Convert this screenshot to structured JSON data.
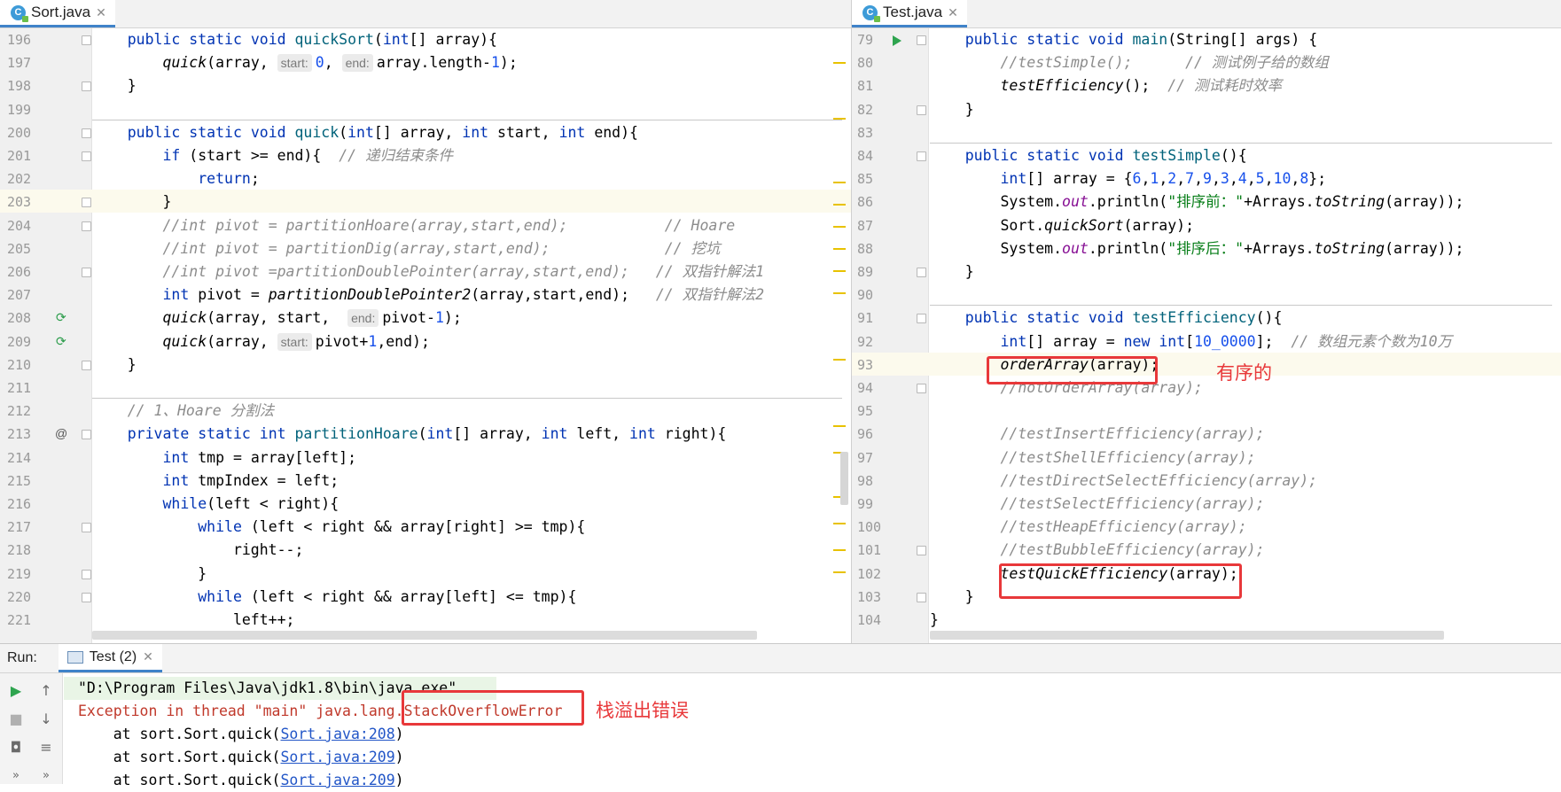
{
  "left_editor": {
    "tab_label": "Sort.java",
    "tab_icon": "java-class-icon",
    "lines": [
      {
        "n": "196",
        "segs": [
          [
            "",
            "    "
          ],
          [
            "kw",
            "public static void "
          ],
          [
            "m",
            "quickSort"
          ],
          [
            "",
            "("
          ],
          [
            "kw",
            "int"
          ],
          [
            "",
            "[] array){"
          ]
        ]
      },
      {
        "n": "197",
        "segs": [
          [
            "",
            "        "
          ],
          [
            "it",
            "quick"
          ],
          [
            "",
            "(array, "
          ],
          [
            "hint",
            "start:"
          ],
          [
            "n",
            "0"
          ],
          [
            "",
            ", "
          ],
          [
            "hint",
            "end:"
          ],
          [
            "",
            "array.length-"
          ],
          [
            "n",
            "1"
          ],
          [
            "",
            ");"
          ]
        ]
      },
      {
        "n": "198",
        "segs": [
          [
            "",
            "    }"
          ]
        ]
      },
      {
        "n": "199",
        "segs": []
      },
      {
        "n": "200",
        "segs": [
          [
            "",
            "    "
          ],
          [
            "kw",
            "public static void "
          ],
          [
            "m",
            "quick"
          ],
          [
            "",
            "("
          ],
          [
            "kw",
            "int"
          ],
          [
            "",
            "[] array, "
          ],
          [
            "kw",
            "int "
          ],
          [
            "",
            "start, "
          ],
          [
            "kw",
            "int "
          ],
          [
            "",
            "end){"
          ]
        ]
      },
      {
        "n": "201",
        "segs": [
          [
            "",
            "        "
          ],
          [
            "kw",
            "if "
          ],
          [
            "",
            "(start >= end){  "
          ],
          [
            "gr",
            "// 递归结束条件"
          ]
        ]
      },
      {
        "n": "202",
        "segs": [
          [
            "",
            "            "
          ],
          [
            "kw",
            "return"
          ],
          [
            "",
            ";"
          ]
        ]
      },
      {
        "n": "203",
        "segs": [
          [
            "",
            "        }"
          ]
        ]
      },
      {
        "n": "204",
        "segs": [
          [
            "",
            "        "
          ],
          [
            "gr",
            "//int pivot = partitionHoare(array,start,end);           // Hoare"
          ]
        ]
      },
      {
        "n": "205",
        "segs": [
          [
            "",
            "        "
          ],
          [
            "gr",
            "//int pivot = partitionDig(array,start,end);             // 挖坑"
          ]
        ]
      },
      {
        "n": "206",
        "segs": [
          [
            "",
            "        "
          ],
          [
            "gr",
            "//int pivot =partitionDoublePointer(array,start,end);   // 双指针解法1"
          ]
        ]
      },
      {
        "n": "207",
        "segs": [
          [
            "",
            "        "
          ],
          [
            "kw",
            "int "
          ],
          [
            "",
            "pivot = "
          ],
          [
            "it",
            "partitionDoublePointer2"
          ],
          [
            "",
            "(array,start,end);   "
          ],
          [
            "gr",
            "// 双指针解法2"
          ]
        ]
      },
      {
        "n": "208",
        "segs": [
          [
            "",
            "        "
          ],
          [
            "it",
            "quick"
          ],
          [
            "",
            "(array, start,  "
          ],
          [
            "hint",
            "end:"
          ],
          [
            "",
            "pivot-"
          ],
          [
            "n",
            "1"
          ],
          [
            "",
            ");"
          ]
        ]
      },
      {
        "n": "209",
        "segs": [
          [
            "",
            "        "
          ],
          [
            "it",
            "quick"
          ],
          [
            "",
            "(array, "
          ],
          [
            "hint",
            "start:"
          ],
          [
            "",
            "pivot+"
          ],
          [
            "n",
            "1"
          ],
          [
            "",
            ",end);"
          ]
        ]
      },
      {
        "n": "210",
        "segs": [
          [
            "",
            "    }"
          ]
        ]
      },
      {
        "n": "211",
        "segs": []
      },
      {
        "n": "212",
        "segs": [
          [
            "",
            "    "
          ],
          [
            "gr",
            "// 1、Hoare 分割法"
          ]
        ]
      },
      {
        "n": "213",
        "segs": [
          [
            "",
            "    "
          ],
          [
            "kw",
            "private static int "
          ],
          [
            "m",
            "partitionHoare"
          ],
          [
            "",
            "("
          ],
          [
            "kw",
            "int"
          ],
          [
            "",
            "[] array, "
          ],
          [
            "kw",
            "int "
          ],
          [
            "",
            "left, "
          ],
          [
            "kw",
            "int "
          ],
          [
            "",
            "right){"
          ]
        ]
      },
      {
        "n": "214",
        "segs": [
          [
            "",
            "        "
          ],
          [
            "kw",
            "int "
          ],
          [
            "",
            "tmp = array[left];"
          ]
        ]
      },
      {
        "n": "215",
        "segs": [
          [
            "",
            "        "
          ],
          [
            "kw",
            "int "
          ],
          [
            "",
            "tmpIndex = left;"
          ]
        ]
      },
      {
        "n": "216",
        "segs": [
          [
            "",
            "        "
          ],
          [
            "kw",
            "while"
          ],
          [
            "",
            "(left < right){"
          ]
        ]
      },
      {
        "n": "217",
        "segs": [
          [
            "",
            "            "
          ],
          [
            "kw",
            "while "
          ],
          [
            "",
            "(left < right && array[right] >= tmp){"
          ]
        ]
      },
      {
        "n": "218",
        "segs": [
          [
            "",
            "                right--;"
          ]
        ]
      },
      {
        "n": "219",
        "segs": [
          [
            "",
            "            }"
          ]
        ]
      },
      {
        "n": "220",
        "segs": [
          [
            "",
            "            "
          ],
          [
            "kw",
            "while "
          ],
          [
            "",
            "(left < right && array[left] <= tmp){"
          ]
        ]
      },
      {
        "n": "221",
        "segs": [
          [
            "",
            "                left++;"
          ]
        ]
      }
    ]
  },
  "right_editor": {
    "tab_label": "Test.java",
    "tab_icon": "java-class-icon",
    "lines": [
      {
        "n": "79",
        "segs": [
          [
            "",
            "    "
          ],
          [
            "kw",
            "public static void "
          ],
          [
            "m",
            "main"
          ],
          [
            "",
            "(String[] args) {"
          ]
        ]
      },
      {
        "n": "80",
        "segs": [
          [
            "",
            "        "
          ],
          [
            "gr",
            "//testSimple();      // 测试例子给的数组"
          ]
        ]
      },
      {
        "n": "81",
        "segs": [
          [
            "",
            "        "
          ],
          [
            "it",
            "testEfficiency"
          ],
          [
            "",
            "();  "
          ],
          [
            "gr",
            "// 测试耗时效率"
          ]
        ]
      },
      {
        "n": "82",
        "segs": [
          [
            "",
            "    }"
          ]
        ]
      },
      {
        "n": "83",
        "segs": []
      },
      {
        "n": "84",
        "segs": [
          [
            "",
            "    "
          ],
          [
            "kw",
            "public static void "
          ],
          [
            "m",
            "testSimple"
          ],
          [
            "",
            "(){"
          ]
        ]
      },
      {
        "n": "85",
        "segs": [
          [
            "",
            "        "
          ],
          [
            "kw",
            "int"
          ],
          [
            "",
            "[] array = {"
          ],
          [
            "n",
            "6"
          ],
          [
            "",
            ","
          ],
          [
            "n",
            "1"
          ],
          [
            "",
            ","
          ],
          [
            "n",
            "2"
          ],
          [
            "",
            ","
          ],
          [
            "n",
            "7"
          ],
          [
            "",
            ","
          ],
          [
            "n",
            "9"
          ],
          [
            "",
            ","
          ],
          [
            "n",
            "3"
          ],
          [
            "",
            ","
          ],
          [
            "n",
            "4"
          ],
          [
            "",
            ","
          ],
          [
            "n",
            "5"
          ],
          [
            "",
            ","
          ],
          [
            "n",
            "10"
          ],
          [
            "",
            ","
          ],
          [
            "n",
            "8"
          ],
          [
            "",
            "};"
          ]
        ]
      },
      {
        "n": "86",
        "segs": [
          [
            "",
            "        System."
          ],
          [
            "pu",
            "out"
          ],
          [
            "",
            ".println("
          ],
          [
            "str",
            "\"排序前：\""
          ],
          [
            "",
            "+Arrays."
          ],
          [
            "it",
            "toString"
          ],
          [
            "",
            "(array));"
          ]
        ]
      },
      {
        "n": "87",
        "segs": [
          [
            "",
            "        Sort."
          ],
          [
            "it",
            "quickSort"
          ],
          [
            "",
            "(array);"
          ]
        ]
      },
      {
        "n": "88",
        "segs": [
          [
            "",
            "        System."
          ],
          [
            "pu",
            "out"
          ],
          [
            "",
            ".println("
          ],
          [
            "str",
            "\"排序后：\""
          ],
          [
            "",
            "+Arrays."
          ],
          [
            "it",
            "toString"
          ],
          [
            "",
            "(array));"
          ]
        ]
      },
      {
        "n": "89",
        "segs": [
          [
            "",
            "    }"
          ]
        ]
      },
      {
        "n": "90",
        "segs": []
      },
      {
        "n": "91",
        "segs": [
          [
            "",
            "    "
          ],
          [
            "kw",
            "public static void "
          ],
          [
            "m",
            "testEfficiency"
          ],
          [
            "",
            "(){"
          ]
        ]
      },
      {
        "n": "92",
        "segs": [
          [
            "",
            "        "
          ],
          [
            "kw",
            "int"
          ],
          [
            "",
            "[] array = "
          ],
          [
            "kw",
            "new int"
          ],
          [
            "",
            "["
          ],
          [
            "n",
            "10_0000"
          ],
          [
            "",
            "];  "
          ],
          [
            "gr",
            "// 数组元素个数为10万"
          ]
        ]
      },
      {
        "n": "93",
        "segs": [
          [
            "",
            "        "
          ],
          [
            "it",
            "orderArray"
          ],
          [
            "",
            "(array);"
          ]
        ]
      },
      {
        "n": "94",
        "segs": [
          [
            "",
            "        "
          ],
          [
            "gr",
            "//notOrderArray(array);"
          ]
        ]
      },
      {
        "n": "95",
        "segs": []
      },
      {
        "n": "96",
        "segs": [
          [
            "",
            "        "
          ],
          [
            "gr",
            "//testInsertEfficiency(array);"
          ]
        ]
      },
      {
        "n": "97",
        "segs": [
          [
            "",
            "        "
          ],
          [
            "gr",
            "//testShellEfficiency(array);"
          ]
        ]
      },
      {
        "n": "98",
        "segs": [
          [
            "",
            "        "
          ],
          [
            "gr",
            "//testDirectSelectEfficiency(array);"
          ]
        ]
      },
      {
        "n": "99",
        "segs": [
          [
            "",
            "        "
          ],
          [
            "gr",
            "//testSelectEfficiency(array);"
          ]
        ]
      },
      {
        "n": "100",
        "segs": [
          [
            "",
            "        "
          ],
          [
            "gr",
            "//testHeapEfficiency(array);"
          ]
        ]
      },
      {
        "n": "101",
        "segs": [
          [
            "",
            "        "
          ],
          [
            "gr",
            "//testBubbleEfficiency(array);"
          ]
        ]
      },
      {
        "n": "102",
        "segs": [
          [
            "",
            "        "
          ],
          [
            "it",
            "testQuickEfficiency"
          ],
          [
            "",
            "(array);"
          ]
        ]
      },
      {
        "n": "103",
        "segs": [
          [
            "",
            "    }"
          ]
        ]
      },
      {
        "n": "104",
        "segs": [
          [
            "",
            "}"
          ]
        ]
      }
    ],
    "annotation_ordered": "有序的"
  },
  "run_panel": {
    "title": "Run:",
    "tab_label": "Test (2)",
    "console": {
      "cmd": "\"D:\\Program Files\\Java\\jdk1.8\\bin\\java.exe\" ...",
      "exception_prefix": "Exception in thread \"main\" java.lang.",
      "exception_name": "StackOverflowError",
      "trace_prefix": "    at sort.Sort.quick(",
      "trace_links": [
        "Sort.java:208",
        "Sort.java:209",
        "Sort.java:209"
      ],
      "trace_suffix": ")"
    },
    "annotation_error": "栈溢出错误"
  },
  "colors": {
    "accent": "#4083c9",
    "annotation": "#e8383a",
    "error_text": "#c0392b",
    "keyword": "#0033b3"
  }
}
